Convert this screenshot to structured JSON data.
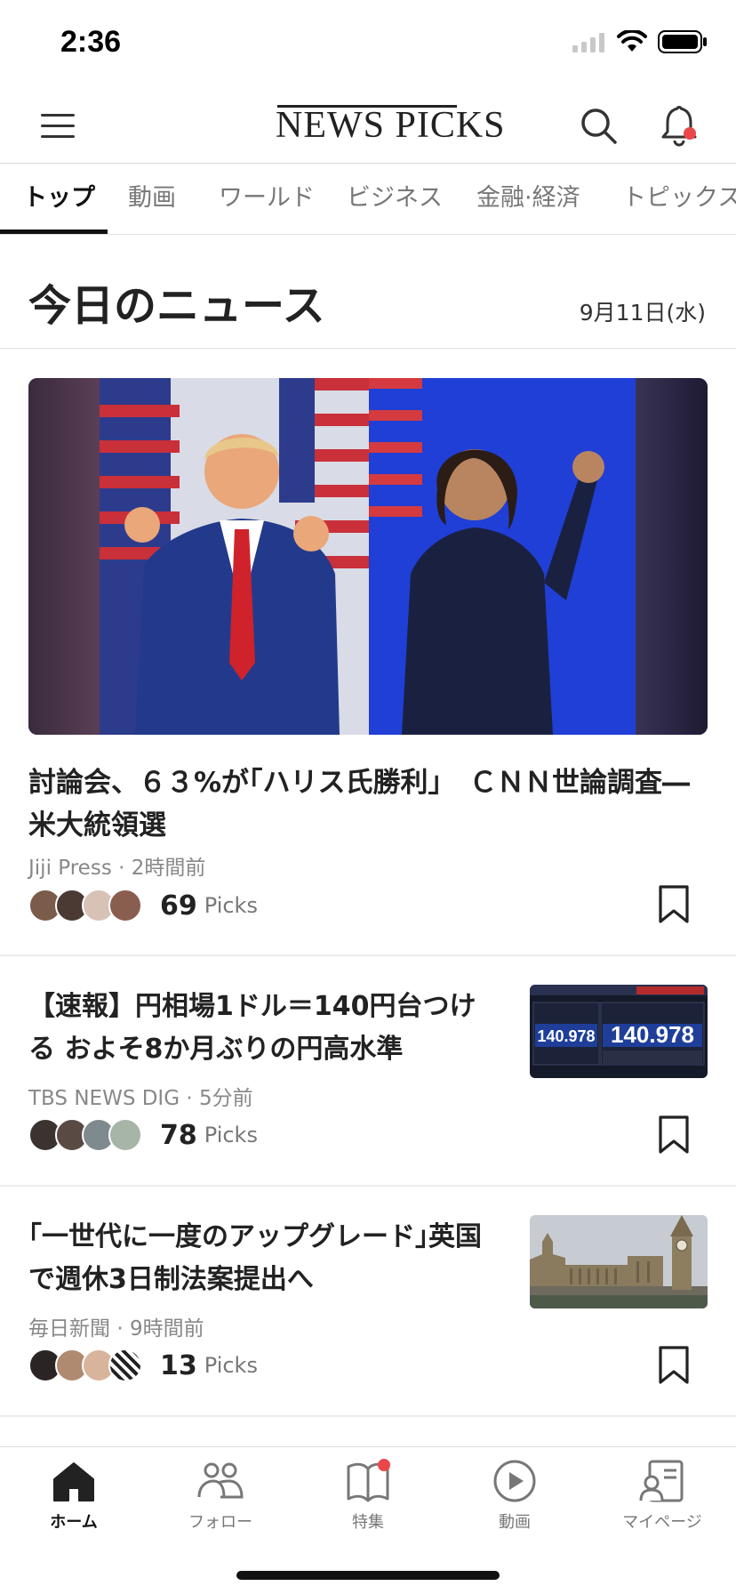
{
  "status_bar": {
    "time": "2:36"
  },
  "header": {
    "logo": "NEWS PICKS"
  },
  "tabs": [
    {
      "label": "トップ",
      "active": true
    },
    {
      "label": "動画"
    },
    {
      "label": "ワールド"
    },
    {
      "label": "ビジネス"
    },
    {
      "label": "金融·経済"
    },
    {
      "label": "トピックス"
    }
  ],
  "section": {
    "title": "今日のニュース",
    "date": "9月11日(水)"
  },
  "articles": [
    {
      "title": "討論会、６３%が｢ハリス氏勝利｣　ＣＮＮ世論調査―米大統領選",
      "source": "Jiji Press",
      "time": "2時間前",
      "picks": "69",
      "picks_label": "Picks"
    },
    {
      "title": "【速報】円相場1ドル＝140円台つける およそ8か月ぶりの円高水準",
      "source": "TBS NEWS DIG",
      "time": "5分前",
      "picks": "78",
      "picks_label": "Picks",
      "thumb_text": {
        "left": "140.978",
        "right": "140.978"
      }
    },
    {
      "title": "｢一世代に一度のアップグレード｣英国で週休3日制法案提出へ",
      "source": "毎日新聞",
      "time": "9時間前",
      "picks": "13",
      "picks_label": "Picks"
    }
  ],
  "bottom_nav": [
    {
      "label": "ホーム",
      "icon": "home-icon",
      "active": true
    },
    {
      "label": "フォロー",
      "icon": "people-icon"
    },
    {
      "label": "特集",
      "icon": "book-icon",
      "badge": true
    },
    {
      "label": "動画",
      "icon": "play-icon"
    },
    {
      "label": "マイページ",
      "icon": "profile-card-icon"
    }
  ],
  "colors": {
    "badge": "#e9474a",
    "accent": "#111111"
  }
}
